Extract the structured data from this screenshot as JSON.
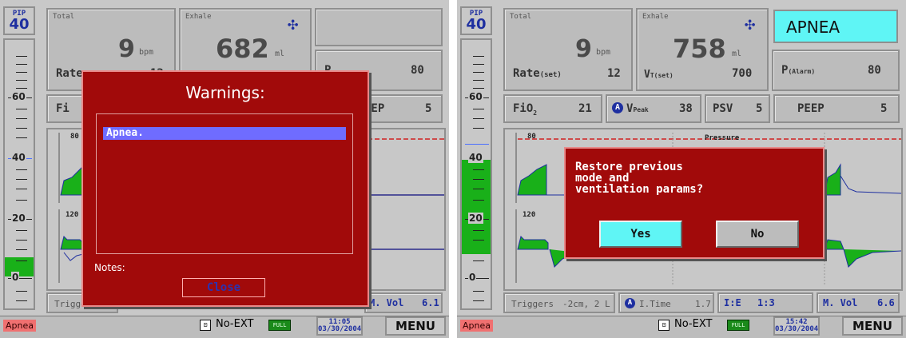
{
  "left": {
    "pip_label": "PIP",
    "pip_value": "40",
    "gauge_labels": [
      "60",
      "40",
      "20",
      "0"
    ],
    "total_label": "Total",
    "rate_value": "9",
    "rate_unit": "bpm",
    "rate_set_label": "Rate",
    "rate_set_value": "12",
    "exhale_label": "Exhale",
    "vt_value": "682",
    "vt_unit": "ml",
    "p_label": "P",
    "p_value": "80",
    "fio2_label": "Fi",
    "peep_label": "EEP",
    "peep_value": "5",
    "wave_top_scale": "80",
    "wave_bot_scale": "120",
    "triggers_label": "Trigger",
    "mvol_label": "M. Vol",
    "mvol_value": "6.1",
    "status_alarm": "Apnea",
    "no_ext": "No-EXT",
    "battery": "FULL",
    "clock_time": "11:05",
    "clock_date": "03/30/2004",
    "menu": "MENU",
    "warn_title": "Warnings:",
    "warn_item": "Apnea.",
    "warn_notes": "Notes:",
    "warn_close": "Close"
  },
  "right": {
    "pip_label": "PIP",
    "pip_value": "40",
    "gauge_labels": [
      "60",
      "40",
      "20",
      "0"
    ],
    "total_label": "Total",
    "rate_value": "9",
    "rate_unit": "bpm",
    "rate_set_label": "Rate",
    "rate_set_sub": "(set)",
    "rate_set_value": "12",
    "exhale_label": "Exhale",
    "vt_value": "758",
    "vt_unit": "ml",
    "vt_set_label": "V",
    "vt_set_sub": "T(set)",
    "vt_set_value": "700",
    "apnea_banner": "APNEA",
    "p_label": "P",
    "p_sub": "(Alarm)",
    "p_value": "80",
    "fio2_label": "FiO",
    "fio2_sub": "2",
    "fio2_value": "21",
    "vpeak_label": "V",
    "vpeak_sub": "Peak",
    "vpeak_value": "38",
    "psv_label": "PSV",
    "psv_value": "5",
    "peep_label": "PEEP",
    "peep_value": "5",
    "wave_title": "Pressure",
    "wave_top_scale": "80",
    "wave_bot_scale": "120",
    "triggers_label": "Triggers",
    "triggers_value": "-2cm, 2 L",
    "itime_label": "I.Time",
    "itime_value": "1.7",
    "ie_label": "I:E",
    "ie_value": "1:3",
    "mvol_label": "M. Vol",
    "mvol_value": "6.6",
    "status_alarm": "Apnea",
    "no_ext": "No-EXT",
    "battery": "FULL",
    "clock_time": "15:42",
    "clock_date": "03/30/2004",
    "menu": "MENU",
    "restore_question": "Restore previous\nmode and\nventilation params?",
    "yes": "Yes",
    "no": "No"
  },
  "colors": {
    "dialog_red": "#a10a0a",
    "apnea_cyan": "#5ff5f5",
    "selection_blue": "#6f6cff",
    "wave_green": "#19b019",
    "value_blue": "#1e2fa0"
  }
}
